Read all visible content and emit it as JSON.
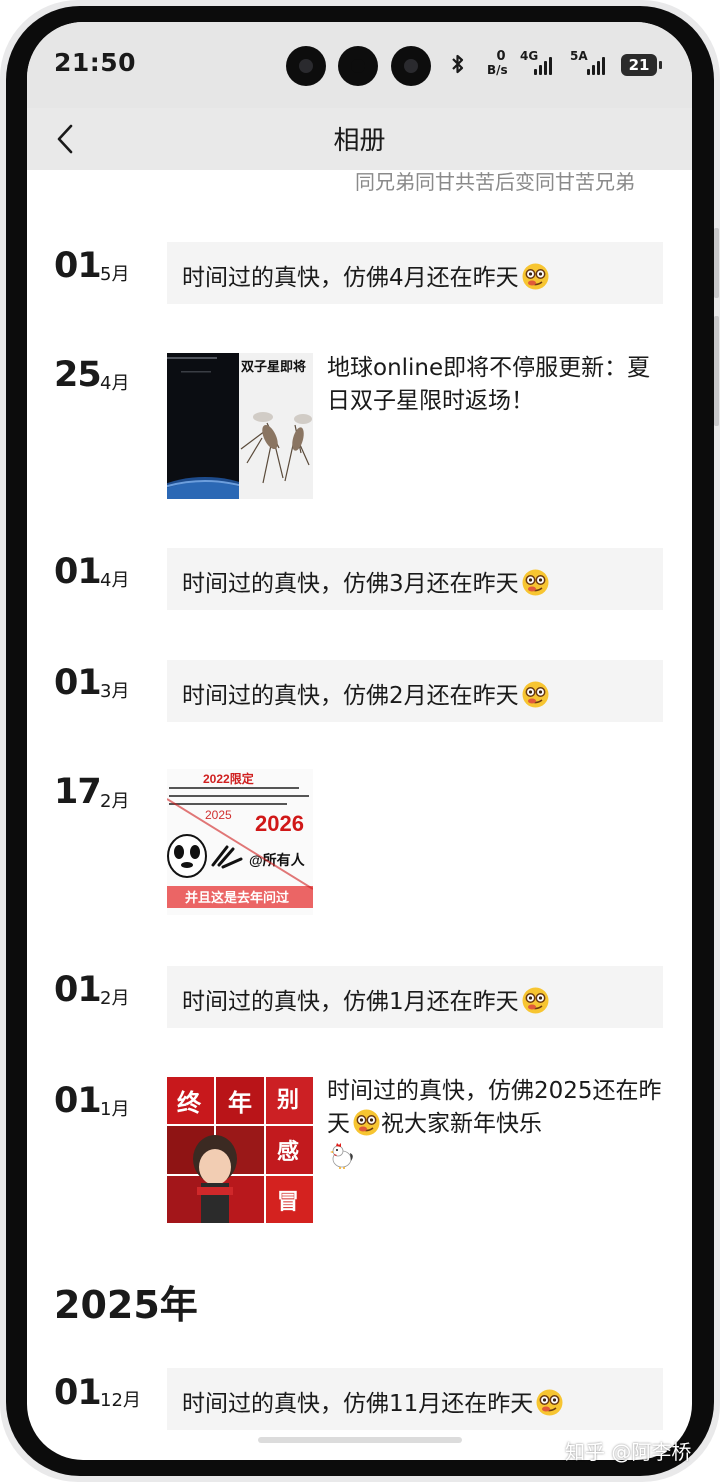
{
  "status_bar": {
    "time": "21:50",
    "net_speed_value": "0",
    "net_speed_unit": "B/s",
    "signal_1_label": "4G",
    "signal_2_label": "5A",
    "battery_level": "21",
    "icons": [
      "bluetooth-icon",
      "signal-bars-icon",
      "battery-icon"
    ]
  },
  "header": {
    "title": "相册",
    "back_icon": "chevron-left-icon"
  },
  "partial_previous_text": "同兄弟同甘共苦后变同甘苦兄弟",
  "posts": [
    {
      "day": "01",
      "month": "5月",
      "text": "时间过的真快，仿佛4月还在昨天",
      "emoji": "nerd-face-emoji"
    },
    {
      "day": "25",
      "month": "4月",
      "text": "地球online即将不停服更新：夏日双子星限时返场！",
      "thumb_text": "双子星即将"
    },
    {
      "day": "01",
      "month": "4月",
      "text": "时间过的真快，仿佛3月还在昨天",
      "emoji": "nerd-face-emoji"
    },
    {
      "day": "01",
      "month": "3月",
      "text": "时间过的真快，仿佛2月还在昨天",
      "emoji": "nerd-face-emoji"
    },
    {
      "day": "17",
      "month": "2月",
      "text": "",
      "thumb_text": {
        "top": "2022限定",
        "year1": "2025",
        "year2": "2026",
        "mention": "@所有人",
        "bottom": "并且这是去年问过"
      }
    },
    {
      "day": "01",
      "month": "2月",
      "text": "时间过的真快，仿佛1月还在昨天",
      "emoji": "nerd-face-emoji"
    },
    {
      "day": "01",
      "month": "1月",
      "text": "时间过的真快，仿佛2025还在昨天",
      "text_2": "祝大家新年快乐",
      "emoji": "nerd-face-emoji",
      "emoji_2": "rooster-emoji",
      "grid_text": [
        "终",
        "年",
        "别",
        "感",
        "冒"
      ]
    },
    {
      "day": "01",
      "month": "12月",
      "text": "时间过的真快，仿佛11月还在昨天",
      "emoji": "nerd-face-emoji"
    }
  ],
  "year_heading": "2025年",
  "watermark": "知乎 @阿李桥",
  "colors": {
    "accent_red": "#c8181c",
    "bubble_bg": "#f4f4f4",
    "status_bar_bg": "#e6e6e6",
    "nav_bar_bg": "#e9e9e9",
    "frame": "#0c0c0c"
  }
}
